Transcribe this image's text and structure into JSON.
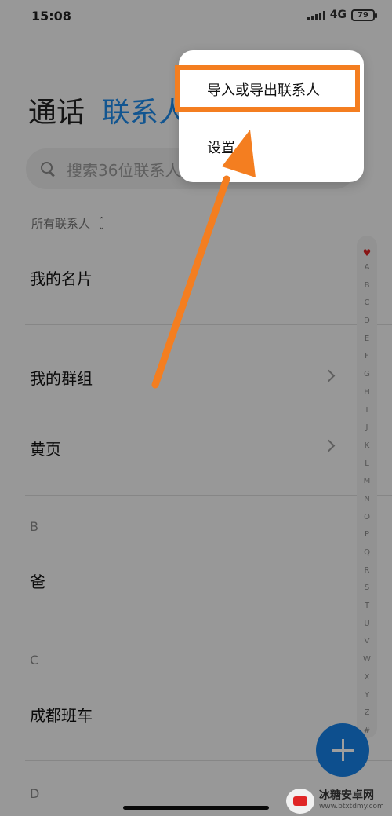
{
  "status_bar": {
    "time": "15:08",
    "network": "4G",
    "battery": "79"
  },
  "tabs": [
    {
      "label": "通话"
    },
    {
      "label": "联系人"
    }
  ],
  "search": {
    "placeholder": "搜索36位联系人"
  },
  "filter": {
    "label": "所有联系人"
  },
  "list": {
    "my_card": "我的名片",
    "my_groups": "我的群组",
    "yellow_pages": "黄页",
    "section_b": "B",
    "contact_b1": "爸",
    "section_c": "C",
    "contact_c1": "成都班车",
    "section_d": "D"
  },
  "alpha_index": [
    "A",
    "B",
    "C",
    "D",
    "E",
    "F",
    "G",
    "H",
    "I",
    "J",
    "K",
    "L",
    "M",
    "N",
    "O",
    "P",
    "Q",
    "R",
    "S",
    "T",
    "U",
    "V",
    "W",
    "X",
    "Y",
    "Z",
    "#"
  ],
  "popup_menu": {
    "items": [
      {
        "label": "导入或导出联系人"
      },
      {
        "label": "设置"
      }
    ]
  },
  "watermark": {
    "title": "冰糖安卓网",
    "url": "www.btxtdmy.com"
  },
  "colors": {
    "accent": "#1d8ae8",
    "fab": "#1680e6",
    "annotation": "#f47e20"
  }
}
